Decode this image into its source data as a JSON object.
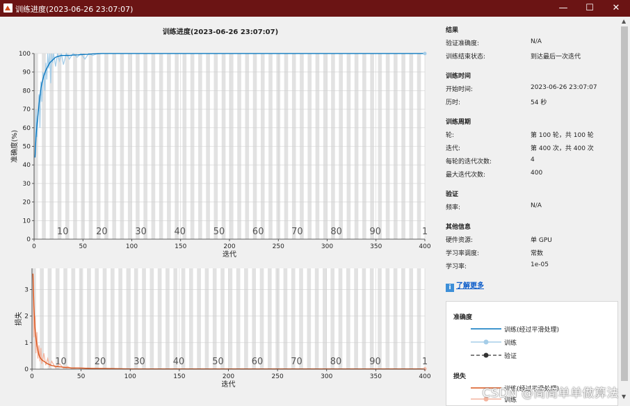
{
  "window": {
    "title": "训练进度(2023-06-26 23:07:07)",
    "minimize": "—",
    "maximize": "☐",
    "close": "✕"
  },
  "plot": {
    "title": "训练进度(2023-06-26 23:07:07)",
    "epoch_labels": [
      "10",
      "20",
      "30",
      "40",
      "50",
      "60",
      "70",
      "80",
      "90",
      "1"
    ]
  },
  "chart_data": [
    {
      "type": "line",
      "title": "训练进度(2023-06-26 23:07:07)",
      "xlabel": "迭代",
      "ylabel": "准确度(%)",
      "xlim": [
        0,
        400
      ],
      "ylim": [
        0,
        100
      ],
      "xticks": [
        0,
        50,
        100,
        150,
        200,
        250,
        300,
        350,
        400
      ],
      "yticks": [
        0,
        10,
        20,
        30,
        40,
        50,
        60,
        70,
        80,
        90,
        100
      ],
      "grid": true,
      "series": [
        {
          "name": "训练(经过平滑处理)",
          "color": "#0072bd",
          "x": [
            1,
            2,
            3,
            4,
            5,
            6,
            7,
            8,
            9,
            10,
            12,
            14,
            16,
            18,
            20,
            22,
            25,
            28,
            32,
            36,
            40,
            45,
            50,
            55,
            60,
            65,
            70,
            80,
            100,
            150,
            200,
            250,
            300,
            350,
            400
          ],
          "y": [
            44,
            55,
            62,
            67,
            72,
            77,
            81,
            84,
            86,
            88,
            91,
            93,
            95,
            96,
            97,
            98,
            98.5,
            99,
            99,
            99,
            99.2,
            99.3,
            99.5,
            99.6,
            99.8,
            99.9,
            100,
            100,
            100,
            100,
            100,
            100,
            100,
            100,
            100
          ]
        },
        {
          "name": "训练",
          "color": "#a5cde8",
          "x": [
            1,
            2,
            3,
            4,
            5,
            6,
            7,
            8,
            9,
            10,
            11,
            12,
            13,
            14,
            15,
            16,
            17,
            18,
            19,
            20,
            22,
            24,
            26,
            28,
            30,
            33,
            36,
            40,
            44,
            48,
            52,
            56,
            60,
            65,
            70,
            100,
            200,
            300,
            400
          ],
          "y": [
            44,
            70,
            55,
            66,
            78,
            60,
            85,
            74,
            90,
            88,
            80,
            95,
            86,
            100,
            92,
            100,
            84,
            100,
            95,
            100,
            93,
            100,
            96,
            100,
            94,
            100,
            97,
            100,
            98,
            100,
            97,
            100,
            99,
            100,
            100,
            100,
            100,
            100,
            100
          ]
        }
      ]
    },
    {
      "type": "line",
      "xlabel": "迭代",
      "ylabel": "损失",
      "xlim": [
        0,
        400
      ],
      "ylim": [
        0,
        3.8
      ],
      "xticks": [
        0,
        50,
        100,
        150,
        200,
        250,
        300,
        350,
        400
      ],
      "yticks": [
        0,
        1,
        2,
        3
      ],
      "grid": true,
      "series": [
        {
          "name": "训练(经过平滑处理)",
          "color": "#d95319",
          "x": [
            1,
            2,
            3,
            4,
            5,
            6,
            7,
            8,
            10,
            12,
            14,
            16,
            18,
            20,
            25,
            30,
            35,
            40,
            50,
            60,
            80,
            100,
            150,
            200,
            300,
            400
          ],
          "y": [
            3.6,
            2.4,
            1.6,
            1.2,
            0.9,
            0.7,
            0.55,
            0.45,
            0.35,
            0.3,
            0.25,
            0.2,
            0.17,
            0.14,
            0.1,
            0.08,
            0.06,
            0.05,
            0.04,
            0.03,
            0.02,
            0.01,
            0.01,
            0.01,
            0.01,
            0.01
          ]
        },
        {
          "name": "训练",
          "color": "#f3b49f",
          "x": [
            1,
            2,
            3,
            4,
            5,
            6,
            7,
            8,
            9,
            10,
            12,
            14,
            16,
            18,
            20,
            24,
            28,
            32,
            36,
            40,
            50,
            60,
            80,
            100,
            200,
            300,
            400
          ],
          "y": [
            3.6,
            1.2,
            2.0,
            0.6,
            1.4,
            0.4,
            0.9,
            0.3,
            0.8,
            0.2,
            0.6,
            0.15,
            0.4,
            0.1,
            0.3,
            0.05,
            0.2,
            0.04,
            0.1,
            0.03,
            0.05,
            0.02,
            0.01,
            0.01,
            0.01,
            0.01,
            0.01
          ]
        }
      ]
    }
  ],
  "info": {
    "results": {
      "heading": "结果",
      "rows": [
        {
          "k": "验证准确度:",
          "v": "N/A"
        },
        {
          "k": "训练结束状态:",
          "v": "到达最后一次迭代"
        }
      ]
    },
    "time": {
      "heading": "训练时间",
      "rows": [
        {
          "k": "开始时间:",
          "v": "2023-06-26 23:07:07"
        },
        {
          "k": "历时:",
          "v": "54 秒"
        }
      ]
    },
    "cycle": {
      "heading": "训练周期",
      "rows": [
        {
          "k": "轮:",
          "v": "第 100 轮，共 100 轮"
        },
        {
          "k": "迭代:",
          "v": "第 400 次，共 400 次"
        },
        {
          "k": "每轮的迭代次数:",
          "v": "4"
        },
        {
          "k": "最大迭代次数:",
          "v": "400"
        }
      ]
    },
    "validation": {
      "heading": "验证",
      "rows": [
        {
          "k": "频率:",
          "v": "N/A"
        }
      ]
    },
    "other": {
      "heading": "其他信息",
      "rows": [
        {
          "k": "硬件资源:",
          "v": "单 GPU"
        },
        {
          "k": "学习率调度:",
          "v": "常数"
        },
        {
          "k": "学习率:",
          "v": "1e-05"
        }
      ]
    },
    "learn_more": "了解更多",
    "info_icon_glyph": "i"
  },
  "legend": {
    "accuracy_heading": "准确度",
    "acc_smoothed": "训练(经过平滑处理)",
    "acc_train": "训练",
    "acc_val": "验证",
    "loss_heading": "损失",
    "loss_smoothed": "训练(经过平滑处理)",
    "loss_train": "训练"
  },
  "scrollbar": {
    "up": "▲",
    "down": "▼"
  },
  "watermark": "CSDN @简简单单做算法"
}
